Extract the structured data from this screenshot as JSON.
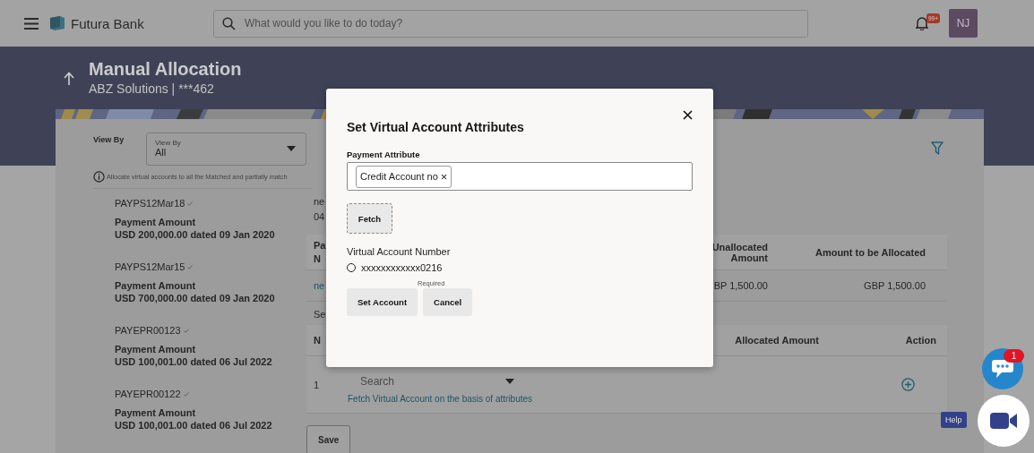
{
  "header": {
    "bank_name": "Futura Bank",
    "search": {
      "placeholder": "What would you like to do today?"
    },
    "notification_badge": "99+",
    "avatar_initials": "NJ"
  },
  "page": {
    "title": "Manual Allocation",
    "subtitle": "ABZ Solutions | ***462"
  },
  "filter": {
    "label": "View By",
    "select": {
      "label": "View By",
      "value": "All"
    }
  },
  "info_note": "Allocate virtual accounts to all the Matched and partially match",
  "payments": [
    {
      "id": "PAYPS12Mar18",
      "label": "Payment Amount",
      "amount": "USD 200,000.00 dated 09 Jan 2020"
    },
    {
      "id": "PAYPS12Mar15",
      "label": "Payment Amount",
      "amount": "USD 700,000.00 dated 09 Jan 2020"
    },
    {
      "id": "PAYEPR00123",
      "label": "Payment Amount",
      "amount": "USD 100,001.00 dated 06 Jul 2022"
    },
    {
      "id": "PAYEPR00122",
      "label": "Payment Amount",
      "amount": "USD 100,001.00 dated 06 Jul 2022"
    }
  ],
  "details": [
    "ne",
    "04"
  ],
  "summary_table": {
    "columns": [
      "Pa N",
      "Unallocated Amount",
      "Amount to be Allocated"
    ],
    "rows": [
      [
        "ne",
        "BP 1,500.00",
        "GBP 1,500.00"
      ]
    ]
  },
  "section_label": "Se",
  "allocation_table": {
    "columns": [
      "N",
      "Allocated Amount",
      "Action"
    ],
    "rows": [
      {
        "number": "1",
        "search": {
          "placeholder": "Search"
        },
        "link": "Fetch Virtual Account on the basis of attributes"
      }
    ]
  },
  "save_button": "Save",
  "modal": {
    "title": "Set Virtual Account Attributes",
    "field_label": "Payment Attribute",
    "chips": [
      {
        "label": "Credit Account no",
        "remove": "×"
      }
    ],
    "fetch_button": "Fetch",
    "accounts_label": "Virtual Account Number",
    "accounts": [
      {
        "number": "xxxxxxxxxxxx0216",
        "selected": false
      }
    ],
    "required_note": "Required",
    "buttons": [
      "Set Account",
      "Cancel"
    ]
  },
  "chat": {
    "badge": "1"
  },
  "help": {
    "label": "Help"
  }
}
